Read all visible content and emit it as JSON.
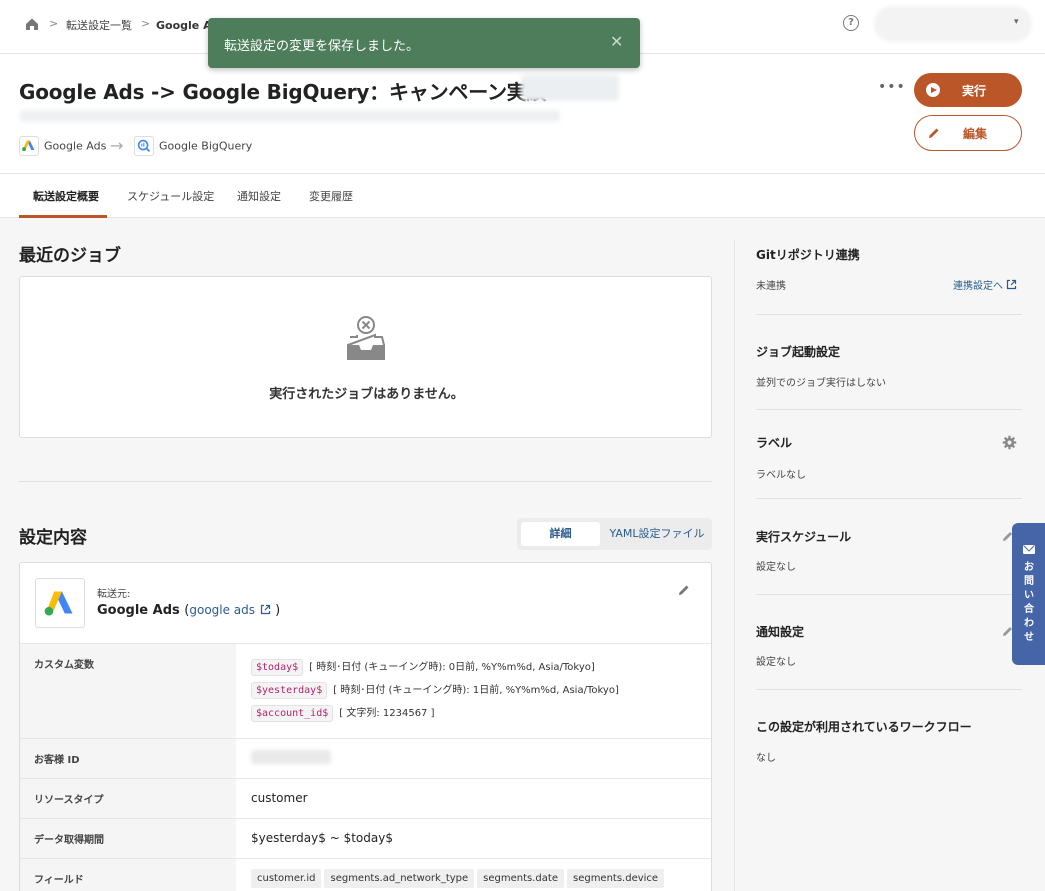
{
  "breadcrumb": {
    "items": [
      "転送設定一覧",
      "Google Ads -> Google BigQuery：キャンペーン実績"
    ]
  },
  "toast": {
    "message": "転送設定の変更を保存しました。",
    "close_glyph": "✕"
  },
  "header": {
    "title": "Google Ads -> Google BigQuery：キャンペーン実績",
    "source_connector": "Google Ads",
    "destination_connector": "Google BigQuery",
    "more_glyph": "•••",
    "run_label": "実行",
    "edit_label": "編集"
  },
  "tabs": [
    "転送設定概要",
    "スケジュール設定",
    "通知設定",
    "変更履歴"
  ],
  "recent_jobs": {
    "title": "最近のジョブ",
    "empty_message": "実行されたジョブはありません。"
  },
  "settings": {
    "title": "設定内容",
    "toggle_detail": "詳細",
    "toggle_yaml": "YAML設定ファイル",
    "source_label": "転送元:",
    "source_name": "Google Ads",
    "source_link": "google ads",
    "rows": {
      "custom_vars_key": "カスタム変数",
      "custom_vars": [
        {
          "name": "$today$",
          "desc": "[ 時刻･日付 (キューイング時): 0日前, %Y%m%d, Asia/Tokyo]"
        },
        {
          "name": "$yesterday$",
          "desc": "[ 時刻･日付 (キューイング時): 1日前, %Y%m%d, Asia/Tokyo]"
        },
        {
          "name": "$account_id$",
          "desc": "[ 文字列: 1234567 ]"
        }
      ],
      "customer_id_key": "お客様 ID",
      "resource_type_key": "リソースタイプ",
      "resource_type_value": "customer",
      "period_key": "データ取得期間",
      "period_value": "$yesterday$ ~ $today$",
      "fields_key": "フィールド",
      "fields": [
        "customer.id",
        "segments.ad_network_type",
        "segments.date",
        "segments.device"
      ]
    }
  },
  "sidebar": {
    "git_title": "Gitリポジトリ連携",
    "git_value": "未連携",
    "git_link": "連携設定へ",
    "job_start_title": "ジョブ起動設定",
    "job_start_value": "並列でのジョブ実行はしない",
    "label_title": "ラベル",
    "label_value": "ラベルなし",
    "schedule_title": "実行スケジュール",
    "schedule_value": "設定なし",
    "notify_title": "通知設定",
    "notify_value": "設定なし",
    "workflow_title": "この設定が利用されているワークフロー",
    "workflow_value": "なし"
  },
  "contact": {
    "chars": [
      "お",
      "問",
      "い",
      "合",
      "わ",
      "せ"
    ]
  },
  "colors": {
    "accent": "#bb5628",
    "toast": "#4d7d5b",
    "link": "#2a5c8f",
    "contact": "#4565a8"
  }
}
